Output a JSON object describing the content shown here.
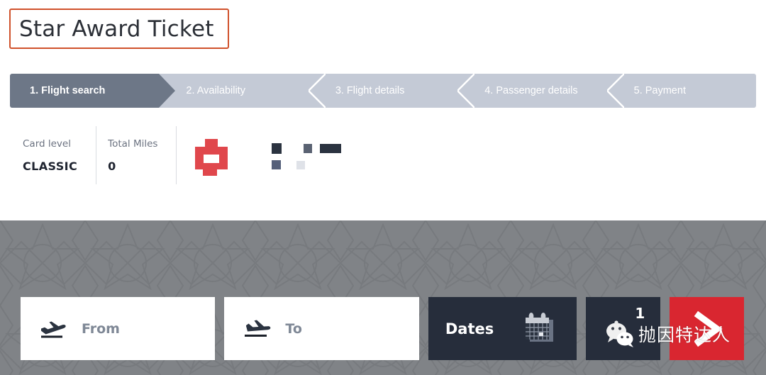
{
  "page": {
    "title": "Star Award Ticket",
    "title_border_color": "#d0512b"
  },
  "steps": {
    "active_index": 0,
    "active_color": "#6d7787",
    "inactive_color": "#c4cad6",
    "items": [
      {
        "label": "1. Flight search"
      },
      {
        "label": "2. Availability"
      },
      {
        "label": "3. Flight details"
      },
      {
        "label": "4. Passenger details"
      },
      {
        "label": "5. Payment"
      }
    ]
  },
  "account": {
    "cells": [
      {
        "label": "Card level",
        "value": "CLASSIC"
      },
      {
        "label": "Total Miles",
        "value": "0"
      }
    ],
    "logo": {
      "name": "airline-logo-redacted",
      "color": "#e0474c"
    },
    "redacted_text_color": "#2b3340"
  },
  "hero": {
    "background_color": "#808387",
    "pattern": "geometric-star-tile"
  },
  "search": {
    "from": {
      "placeholder": "From",
      "icon": "plane-takeoff-icon"
    },
    "to": {
      "placeholder": "To",
      "icon": "plane-landing-icon"
    },
    "dates": {
      "label": "Dates",
      "icon": "calendar-icon",
      "background": "#262d3b"
    },
    "passengers": {
      "count": "1",
      "background": "#262d3b"
    },
    "submit": {
      "icon": "chevron-right-icon",
      "background": "#d92630"
    }
  },
  "watermark": {
    "icon": "wechat-icon",
    "text": "抛因特达人"
  }
}
